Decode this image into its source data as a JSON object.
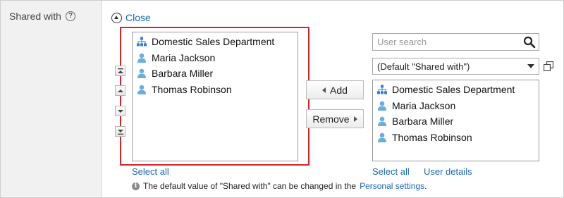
{
  "field": {
    "label": "Shared with",
    "help_icon": "help-circle-icon"
  },
  "close_link": {
    "label": "Close",
    "icon": "collapse-up-icon"
  },
  "left_list": {
    "items": [
      {
        "label": "Domestic Sales Department",
        "icon": "organization-icon"
      },
      {
        "label": "Maria Jackson",
        "icon": "user-icon"
      },
      {
        "label": "Barbara Miller",
        "icon": "user-icon"
      },
      {
        "label": "Thomas Robinson",
        "icon": "user-icon"
      }
    ],
    "select_all": "Select all"
  },
  "order_buttons": [
    "move-to-top",
    "move-up",
    "move-down",
    "move-to-bottom"
  ],
  "buttons": {
    "add": "Add",
    "remove": "Remove"
  },
  "search": {
    "placeholder": "User search",
    "value": ""
  },
  "group_select": {
    "selected": "(Default \"Shared with\")"
  },
  "right_list": {
    "items": [
      {
        "label": "Domestic Sales Department",
        "icon": "organization-icon"
      },
      {
        "label": "Maria Jackson",
        "icon": "user-icon"
      },
      {
        "label": "Barbara Miller",
        "icon": "user-icon"
      },
      {
        "label": "Thomas Robinson",
        "icon": "user-icon"
      }
    ],
    "select_all": "Select all",
    "user_details": "User details"
  },
  "note": {
    "text": "The default value of \"Shared with\" can be changed in the",
    "link": "Personal settings",
    "end": "."
  },
  "colors": {
    "link": "#1a66b8",
    "highlight": "#d9232c",
    "user_icon": "#6aaee0",
    "org_icon": "#2f7fd0"
  }
}
